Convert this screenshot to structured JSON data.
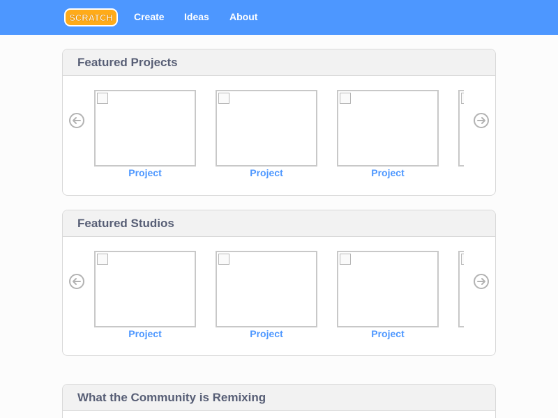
{
  "navbar": {
    "logo_text": "SCRATCH",
    "links": [
      "Create",
      "Ideas",
      "About"
    ],
    "colors": {
      "background": "#4d97ff",
      "text": "#ffffff",
      "logo": "#ffab19"
    }
  },
  "sections": [
    {
      "title": "Featured Projects",
      "prev_icon": "arrow-left-circle-icon",
      "next_icon": "arrow-right-circle-icon",
      "items": [
        {
          "label": "Project",
          "image_icon": "broken-image-icon"
        },
        {
          "label": "Project",
          "image_icon": "broken-image-icon"
        },
        {
          "label": "Project",
          "image_icon": "broken-image-icon"
        },
        {
          "label": "",
          "image_icon": "broken-image-icon"
        }
      ]
    },
    {
      "title": "Featured Studios",
      "prev_icon": "arrow-left-circle-icon",
      "next_icon": "arrow-right-circle-icon",
      "items": [
        {
          "label": "Project",
          "image_icon": "broken-image-icon"
        },
        {
          "label": "Project",
          "image_icon": "broken-image-icon"
        },
        {
          "label": "Project",
          "image_icon": "broken-image-icon"
        },
        {
          "label": "",
          "image_icon": "broken-image-icon"
        }
      ]
    },
    {
      "title": "What the Community is Remixing"
    }
  ]
}
